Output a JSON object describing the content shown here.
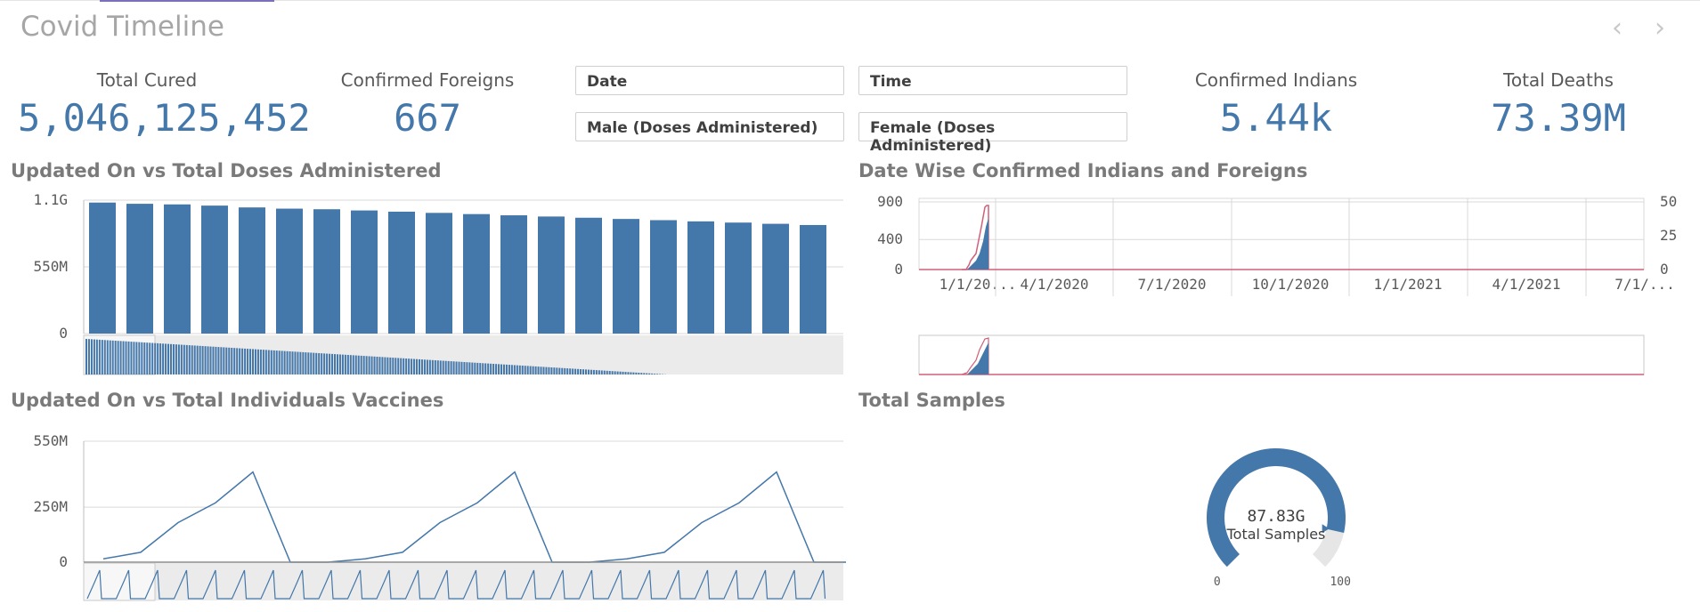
{
  "app": {
    "title": "Covid Timeline"
  },
  "nav": {
    "prev": "‹",
    "next": "›"
  },
  "kpis": [
    {
      "label": "Total Cured",
      "value": "5,046,125,452"
    },
    {
      "label": "Confirmed Foreigns",
      "value": "667"
    },
    {
      "label": "Confirmed Indians",
      "value": "5.44k"
    },
    {
      "label": "Total Deaths",
      "value": "73.39M"
    }
  ],
  "filters": [
    "Date",
    "Time",
    "Male (Doses Administered)",
    "Female (Doses Administered)"
  ],
  "colors": {
    "bar": "#4477aa",
    "line": "#4477aa",
    "red_line": "#d0607a",
    "grid": "#d9d9d9",
    "scroll_bg": "#ebebeb"
  },
  "panels": {
    "doses": {
      "title": "Updated On vs Total Doses Administered"
    },
    "indians": {
      "title": "Date Wise Confirmed Indians and Foreigns"
    },
    "vaccines": {
      "title": "Updated On vs Total Individuals Vaccines"
    },
    "samples": {
      "title": "Total Samples"
    }
  },
  "chart_data": [
    {
      "type": "bar",
      "y_ticks": [
        "1.1G",
        "550M",
        "0"
      ],
      "ylim": [
        0,
        1100000000
      ],
      "values": [
        1080000000,
        1070000000,
        1065000000,
        1055000000,
        1040000000,
        1030000000,
        1025000000,
        1015000000,
        1005000000,
        995000000,
        985000000,
        975000000,
        965000000,
        955000000,
        945000000,
        935000000,
        925000000,
        915000000,
        905000000,
        895000000
      ],
      "grid": true
    },
    {
      "type": "line",
      "x_ticks": [
        "1/1/20...",
        "4/1/2020",
        "7/1/2020",
        "10/1/2020",
        "1/1/2021",
        "4/1/2021",
        "7/1/..."
      ],
      "y_left_ticks": [
        "900",
        "400",
        "0"
      ],
      "y_right_ticks": [
        "50",
        "25",
        "0"
      ],
      "ylim_left": [
        0,
        900
      ],
      "ylim_right": [
        0,
        50
      ],
      "grid": true
    },
    {
      "type": "line",
      "y_ticks": [
        "550M",
        "250M",
        "0"
      ],
      "ylim": [
        0,
        550000000
      ],
      "values": [
        15000000,
        45000000,
        180000000,
        270000000,
        410000000,
        0,
        0,
        15000000,
        45000000,
        180000000,
        270000000,
        410000000,
        0,
        0,
        15000000,
        45000000,
        180000000,
        270000000,
        410000000,
        0,
        0
      ],
      "grid": true
    },
    {
      "type": "gauge",
      "value_label": "87.83G",
      "label": "Total Samples",
      "min": "0",
      "max": "100",
      "fraction": 0.88
    }
  ]
}
